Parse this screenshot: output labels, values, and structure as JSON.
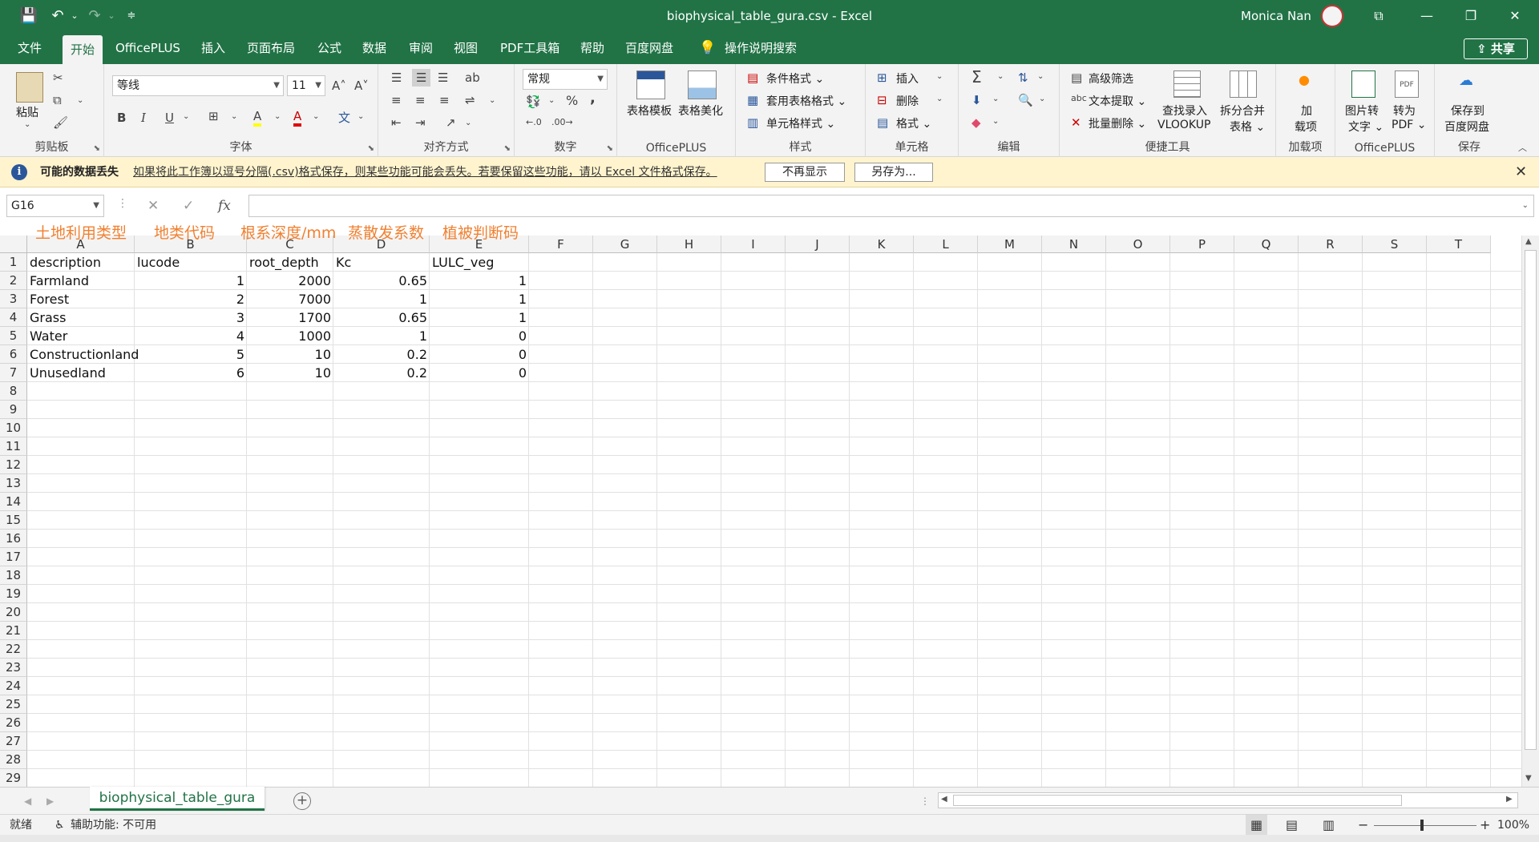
{
  "title_bar": {
    "title": "biophysical_table_gura.csv  -  Excel",
    "user": "Monica Nan",
    "quick_access": {
      "save": "💾",
      "undo": "↶",
      "redo": "↷",
      "more": "⌄",
      "customize": "≑"
    },
    "controls": {
      "restore_ribbon": "⧉",
      "minimize": "—",
      "maximize": "❐",
      "close": "✕"
    }
  },
  "tabs": [
    "文件",
    "开始",
    "OfficePLUS",
    "插入",
    "页面布局",
    "公式",
    "数据",
    "审阅",
    "视图",
    "PDF工具箱",
    "帮助",
    "百度网盘"
  ],
  "active_tab": "开始",
  "tell_me": "操作说明搜索",
  "share": "共享",
  "ribbon": {
    "clipboard": {
      "label": "剪贴板",
      "paste": "粘贴"
    },
    "font": {
      "label": "字体",
      "name": "等线",
      "size": "11",
      "bold": "B",
      "italic": "I",
      "underline": "U",
      "grow": "A˄",
      "shrink": "A˅",
      "fill": "A",
      "color": "A",
      "phonetic": "文"
    },
    "alignment": {
      "label": "对齐方式"
    },
    "number": {
      "label": "数字",
      "format": "常规",
      "percent": "%",
      "comma": ","
    },
    "officeplus": {
      "label": "OfficePLUS",
      "template": "表格模板",
      "beautify": "表格美化"
    },
    "styles": {
      "label": "样式",
      "conditional": "条件格式",
      "table_format": "套用表格格式",
      "cell_styles": "单元格样式"
    },
    "cells": {
      "label": "单元格",
      "insert": "插入",
      "delete": "删除",
      "format": "格式"
    },
    "editing": {
      "label": "编辑",
      "sum": "Σ"
    },
    "quick_tools": {
      "label": "便捷工具",
      "advanced_filter": "高级筛选",
      "text_extract": "文本提取",
      "batch_delete": "批量删除",
      "lookup_1": "查找录入",
      "lookup_2": "VLOOKUP",
      "split_1": "拆分合并",
      "split_2": "表格"
    },
    "addins": {
      "label": "加载项",
      "line1": "加",
      "line2": "载项"
    },
    "officeplus2": {
      "label": "OfficePLUS",
      "img_1": "图片转",
      "img_2": "文字",
      "pdf_1": "转为",
      "pdf_2": "PDF"
    },
    "save": {
      "label": "保存",
      "line1": "保存到",
      "line2": "百度网盘"
    }
  },
  "message_bar": {
    "title": "可能的数据丢失",
    "text": "如果将此工作簿以逗号分隔(.csv)格式保存，则某些功能可能会丢失。若要保留这些功能，请以 Excel 文件格式保存。",
    "btn_dismiss": "不再显示",
    "btn_save_as": "另存为..."
  },
  "formula_bar": {
    "name_box": "G16",
    "cancel": "✕",
    "enter": "✓",
    "fx": "fx",
    "formula": ""
  },
  "annotations": [
    "土地利用类型",
    "地类代码",
    "根系深度/mm",
    "蒸散发系数",
    "植被判断码"
  ],
  "columns": [
    "A",
    "B",
    "C",
    "D",
    "E",
    "F",
    "G",
    "H",
    "I",
    "J",
    "K",
    "L",
    "M",
    "N",
    "O",
    "P",
    "Q",
    "R",
    "S",
    "T"
  ],
  "rows": [
    "1",
    "2",
    "3",
    "4",
    "5",
    "6",
    "7",
    "8",
    "9",
    "10",
    "11",
    "12",
    "13",
    "14",
    "15",
    "16",
    "17",
    "18",
    "19",
    "20",
    "21",
    "22",
    "23",
    "24",
    "25",
    "26",
    "27",
    "28",
    "29"
  ],
  "table": {
    "headers": [
      "description",
      "lucode",
      "root_depth",
      "Kc",
      "LULC_veg"
    ],
    "rows": [
      [
        "Farmland",
        "1",
        "2000",
        "0.65",
        "1"
      ],
      [
        "Forest",
        "2",
        "7000",
        "1",
        "1"
      ],
      [
        "Grass",
        "3",
        "1700",
        "0.65",
        "1"
      ],
      [
        "Water",
        "4",
        "1000",
        "1",
        "0"
      ],
      [
        "Constructionland",
        "5",
        "10",
        "0.2",
        "0"
      ],
      [
        "Unusedland",
        "6",
        "10",
        "0.2",
        "0"
      ]
    ]
  },
  "sheet_tab": "biophysical_table_gura",
  "status": {
    "ready": "就绪",
    "accessibility": "辅助功能: 不可用",
    "zoom": "100%",
    "zoom_minus": "−",
    "zoom_plus": "+"
  }
}
